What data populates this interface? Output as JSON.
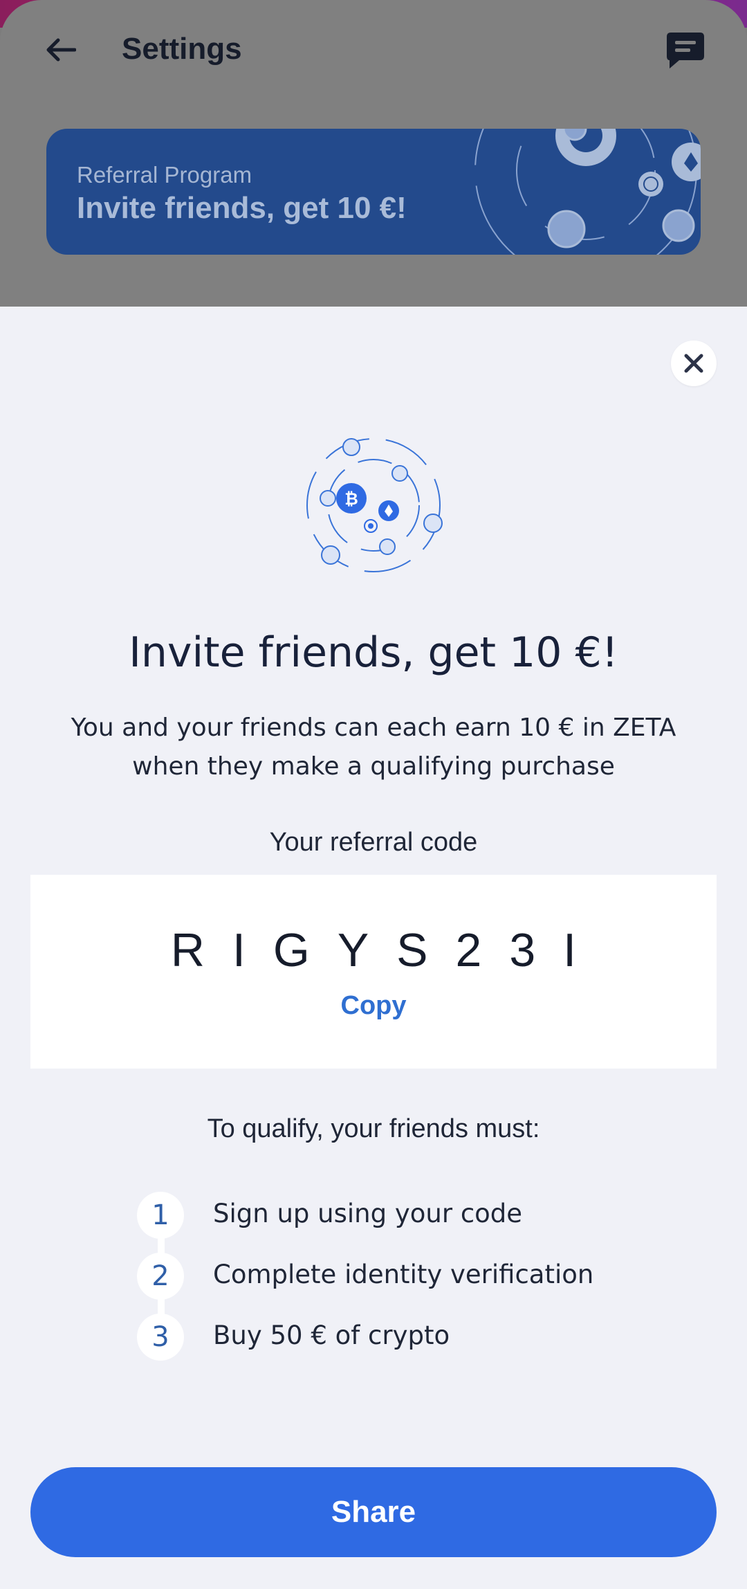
{
  "header": {
    "title": "Settings",
    "back_icon": "arrow-left-icon",
    "chat_icon": "chat-icon"
  },
  "banner": {
    "subtitle": "Referral Program",
    "title": "Invite friends, get 10 €!"
  },
  "sheet": {
    "close_icon": "close-icon",
    "headline": "Invite friends, get 10 €!",
    "description": "You and your friends can each earn 10 € in ZETA when they make a qualifying purchase",
    "code_label": "Your referral code",
    "code": "RIGYS23I",
    "copy_label": "Copy",
    "qualify_heading": "To qualify, your friends must:",
    "steps": [
      {
        "number": "1",
        "text": "Sign up using your code"
      },
      {
        "number": "2",
        "text": "Complete identity verification"
      },
      {
        "number": "3",
        "text": "Buy 50 € of crypto"
      }
    ],
    "share_label": "Share"
  },
  "colors": {
    "accent": "#2f6ae3",
    "link": "#2f6fd1",
    "sheet_bg": "#f0f1f7",
    "banner_bg": "#234a8c"
  }
}
